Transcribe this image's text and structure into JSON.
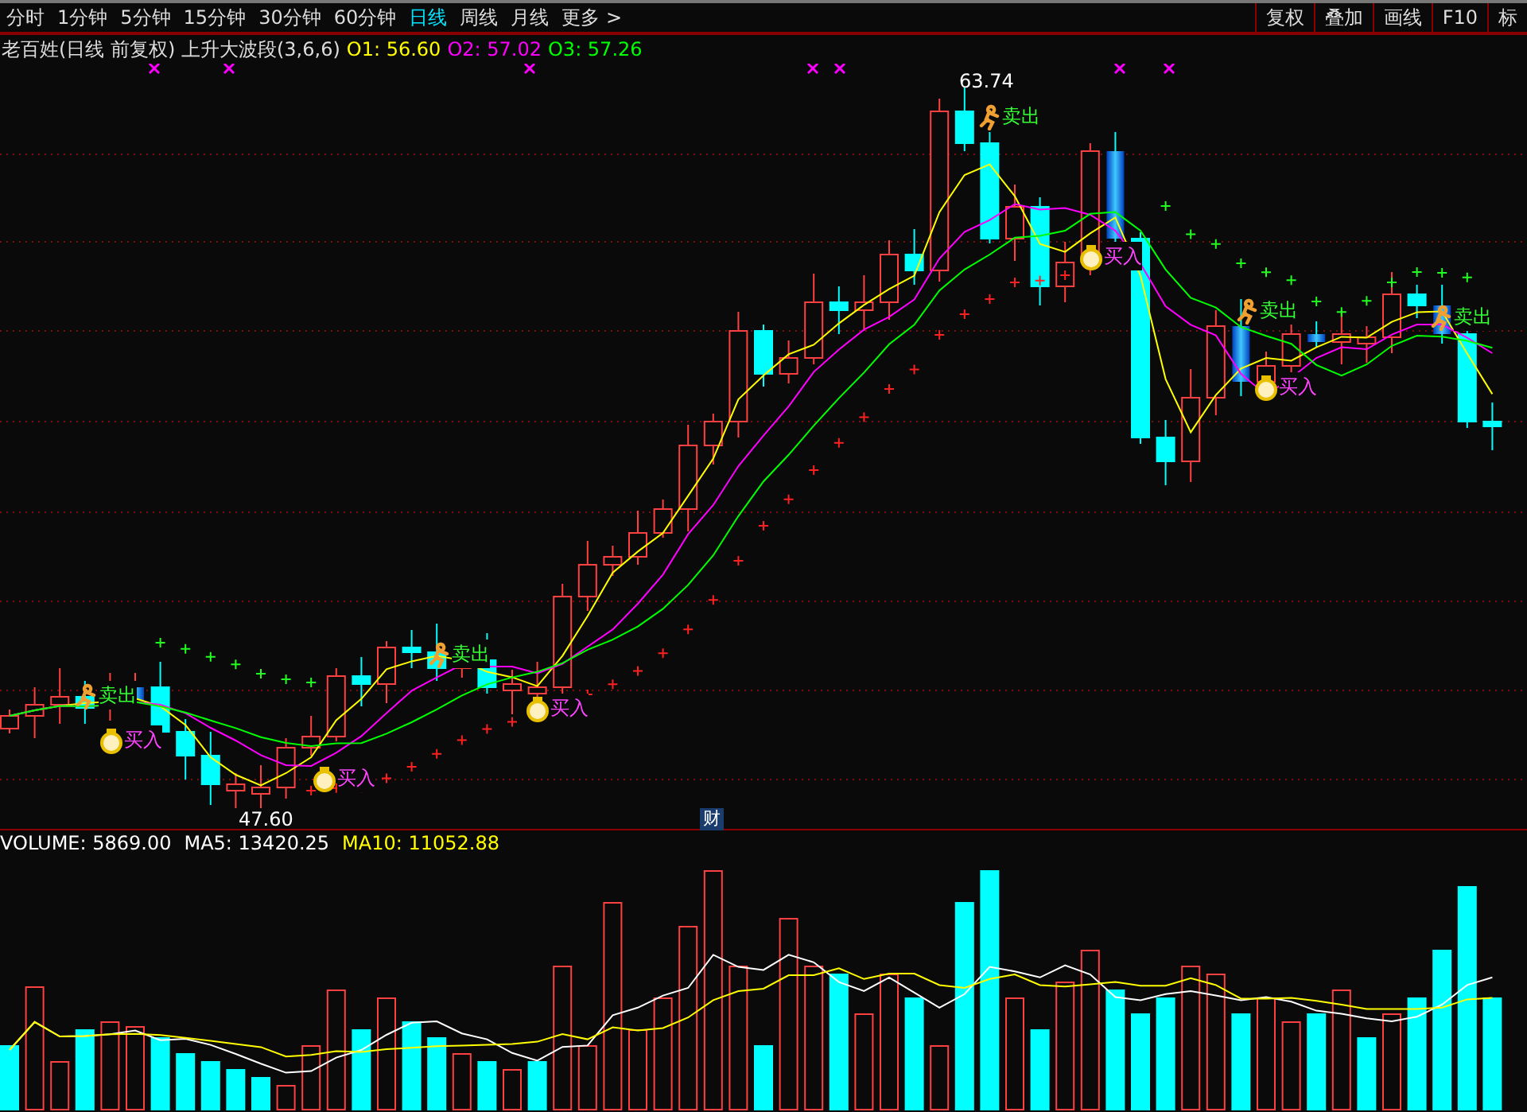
{
  "period_tabs": [
    {
      "label": "分时",
      "selected": false
    },
    {
      "label": "1分钟",
      "selected": false
    },
    {
      "label": "5分钟",
      "selected": false
    },
    {
      "label": "15分钟",
      "selected": false
    },
    {
      "label": "30分钟",
      "selected": false
    },
    {
      "label": "60分钟",
      "selected": false
    },
    {
      "label": "日线",
      "selected": true
    },
    {
      "label": "周线",
      "selected": false
    },
    {
      "label": "月线",
      "selected": false
    },
    {
      "label": "更多 >",
      "selected": false
    }
  ],
  "tool_buttons": [
    "复权",
    "叠加",
    "画线",
    "F10",
    "标"
  ],
  "price_legend": {
    "title": "老百姓(日线 前复权) 上升大波段(3,6,6)",
    "items": [
      {
        "label": "O1: 56.60",
        "color": "#ffff00"
      },
      {
        "label": "O2: 57.02",
        "color": "#ff00ff"
      },
      {
        "label": "O3: 57.26",
        "color": "#00ff00"
      }
    ]
  },
  "price_chart": {
    "high_label": "63.74",
    "low_label": "47.60",
    "finance_badge": "财",
    "signals": [
      {
        "kind": "sell",
        "label": "卖出"
      },
      {
        "kind": "buy",
        "label": "买入"
      },
      {
        "kind": "buy",
        "label": "买入"
      },
      {
        "kind": "sell",
        "label": "卖出"
      },
      {
        "kind": "buy",
        "label": "买入"
      },
      {
        "kind": "sell",
        "label": "卖出"
      },
      {
        "kind": "buy",
        "label": "买入"
      },
      {
        "kind": "sell",
        "label": "卖出"
      },
      {
        "kind": "buy",
        "label": "买入"
      },
      {
        "kind": "sell",
        "label": "卖出"
      }
    ]
  },
  "volume_legend": [
    {
      "label": "VOLUME: 5869.00",
      "color": "#ffffff"
    },
    {
      "label": "MA5: 13420.25",
      "color": "#ffffff"
    },
    {
      "label": "MA10: 11052.88",
      "color": "#ffff00"
    }
  ]
}
